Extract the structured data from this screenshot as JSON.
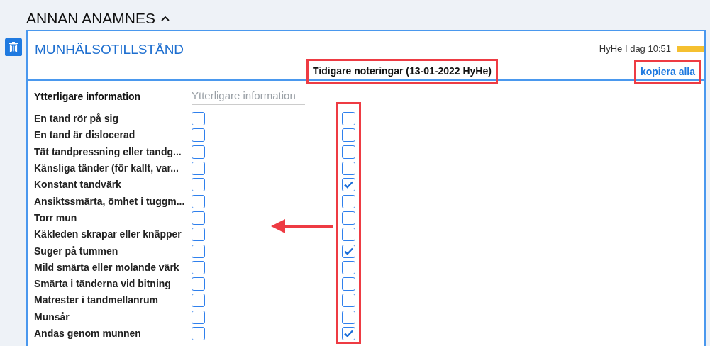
{
  "section": {
    "title": "ANNAN ANAMNES",
    "expanded": true
  },
  "card": {
    "title": "MUNHÄLSOTILLSTÅND",
    "timestamp": "HyHe I dag 10:51",
    "previous_notes": "Tidigare noteringar (13-01-2022 HyHe)",
    "copy_all": "kopiera alla",
    "additional_info": {
      "label": "Ytterligare information",
      "placeholder": "Ytterligare information"
    },
    "items": [
      {
        "label": "En tand rör på sig",
        "checked": false,
        "previous_checked": false
      },
      {
        "label": "En tand är dislocerad",
        "checked": false,
        "previous_checked": false
      },
      {
        "label": "Tät tandpressning eller tandg...",
        "checked": false,
        "previous_checked": false
      },
      {
        "label": "Känsliga tänder (för kallt, var...",
        "checked": false,
        "previous_checked": false
      },
      {
        "label": "Konstant tandvärk",
        "checked": false,
        "previous_checked": true
      },
      {
        "label": "Ansiktssmärta, ömhet i tuggm...",
        "checked": false,
        "previous_checked": false
      },
      {
        "label": "Torr mun",
        "checked": false,
        "previous_checked": false
      },
      {
        "label": "Käkleden skrapar eller knäpper",
        "checked": false,
        "previous_checked": false
      },
      {
        "label": "Suger på tummen",
        "checked": false,
        "previous_checked": true
      },
      {
        "label": "Mild smärta eller molande värk",
        "checked": false,
        "previous_checked": false
      },
      {
        "label": "Smärta i tänderna vid bitning",
        "checked": false,
        "previous_checked": false
      },
      {
        "label": "Matrester i tandmellanrum",
        "checked": false,
        "previous_checked": false
      },
      {
        "label": "Munsår",
        "checked": false,
        "previous_checked": false
      },
      {
        "label": "Andas genom munnen",
        "checked": false,
        "previous_checked": true
      }
    ]
  }
}
